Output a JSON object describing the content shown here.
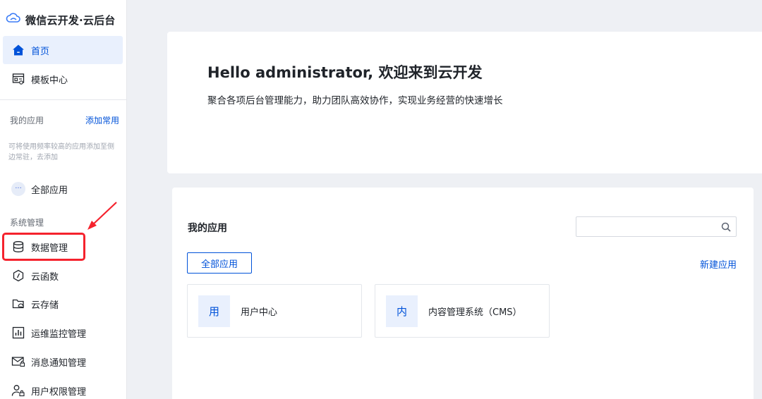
{
  "brand": {
    "title": "微信云开发·云后台",
    "logo_icon": "cloud-logo-icon"
  },
  "nav": {
    "home": "首页",
    "templates": "模板中心"
  },
  "my_apps_section": {
    "label": "我的应用",
    "add_common": "添加常用",
    "hint": "可将使用频率较高的应用添加至侧边常驻，去添加",
    "all_apps": "全部应用"
  },
  "system_section": {
    "label": "系统管理",
    "items": [
      {
        "label": "数据管理",
        "icon": "database-icon"
      },
      {
        "label": "云函数",
        "icon": "cloud-function-icon"
      },
      {
        "label": "云存储",
        "icon": "cloud-storage-icon"
      },
      {
        "label": "运维监控管理",
        "icon": "monitor-chart-icon"
      },
      {
        "label": "消息通知管理",
        "icon": "message-lock-icon"
      },
      {
        "label": "用户权限管理",
        "icon": "user-lock-icon"
      }
    ]
  },
  "hero": {
    "title": "Hello administrator, 欢迎来到云开发",
    "subtitle": "聚合各项后台管理能力，助力团队高效协作，实现业务经营的快速增长"
  },
  "apps_panel": {
    "title": "我的应用",
    "search_placeholder": "",
    "all_apps_button": "全部应用",
    "new_app": "新建应用",
    "cards": [
      {
        "avatar": "用",
        "name": "用户中心"
      },
      {
        "avatar": "内",
        "name": "内容管理系统（CMS）"
      }
    ]
  },
  "colors": {
    "accent": "#0052d9",
    "highlight": "#f5222d",
    "background": "#eef0f4"
  }
}
